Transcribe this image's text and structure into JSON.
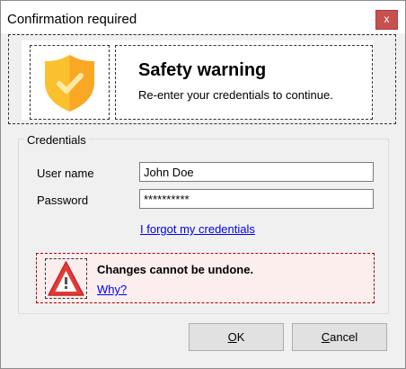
{
  "window": {
    "title": "Confirmation required",
    "close_glyph": "x"
  },
  "header": {
    "icon": "shield-check-icon",
    "title": "Safety warning",
    "subtitle": "Re-enter your credentials to continue."
  },
  "credentials": {
    "group_label": "Credentials",
    "username_label": "User name",
    "username_value": "John Doe",
    "password_label": "Password",
    "password_value": "**********",
    "forgot_link": "I forgot my credentials"
  },
  "warning": {
    "icon": "warning-triangle-icon",
    "title": "Changes cannot be undone.",
    "link": "Why?"
  },
  "buttons": {
    "ok_mnemonic": "O",
    "ok_rest": "K",
    "cancel_mnemonic": "C",
    "cancel_rest": "ancel"
  },
  "colors": {
    "shield": "#fbc02d",
    "shield_shade": "#f9a825",
    "warning_red": "#e53935",
    "close_button": "#c75050",
    "warning_bg": "#fdeeee"
  }
}
